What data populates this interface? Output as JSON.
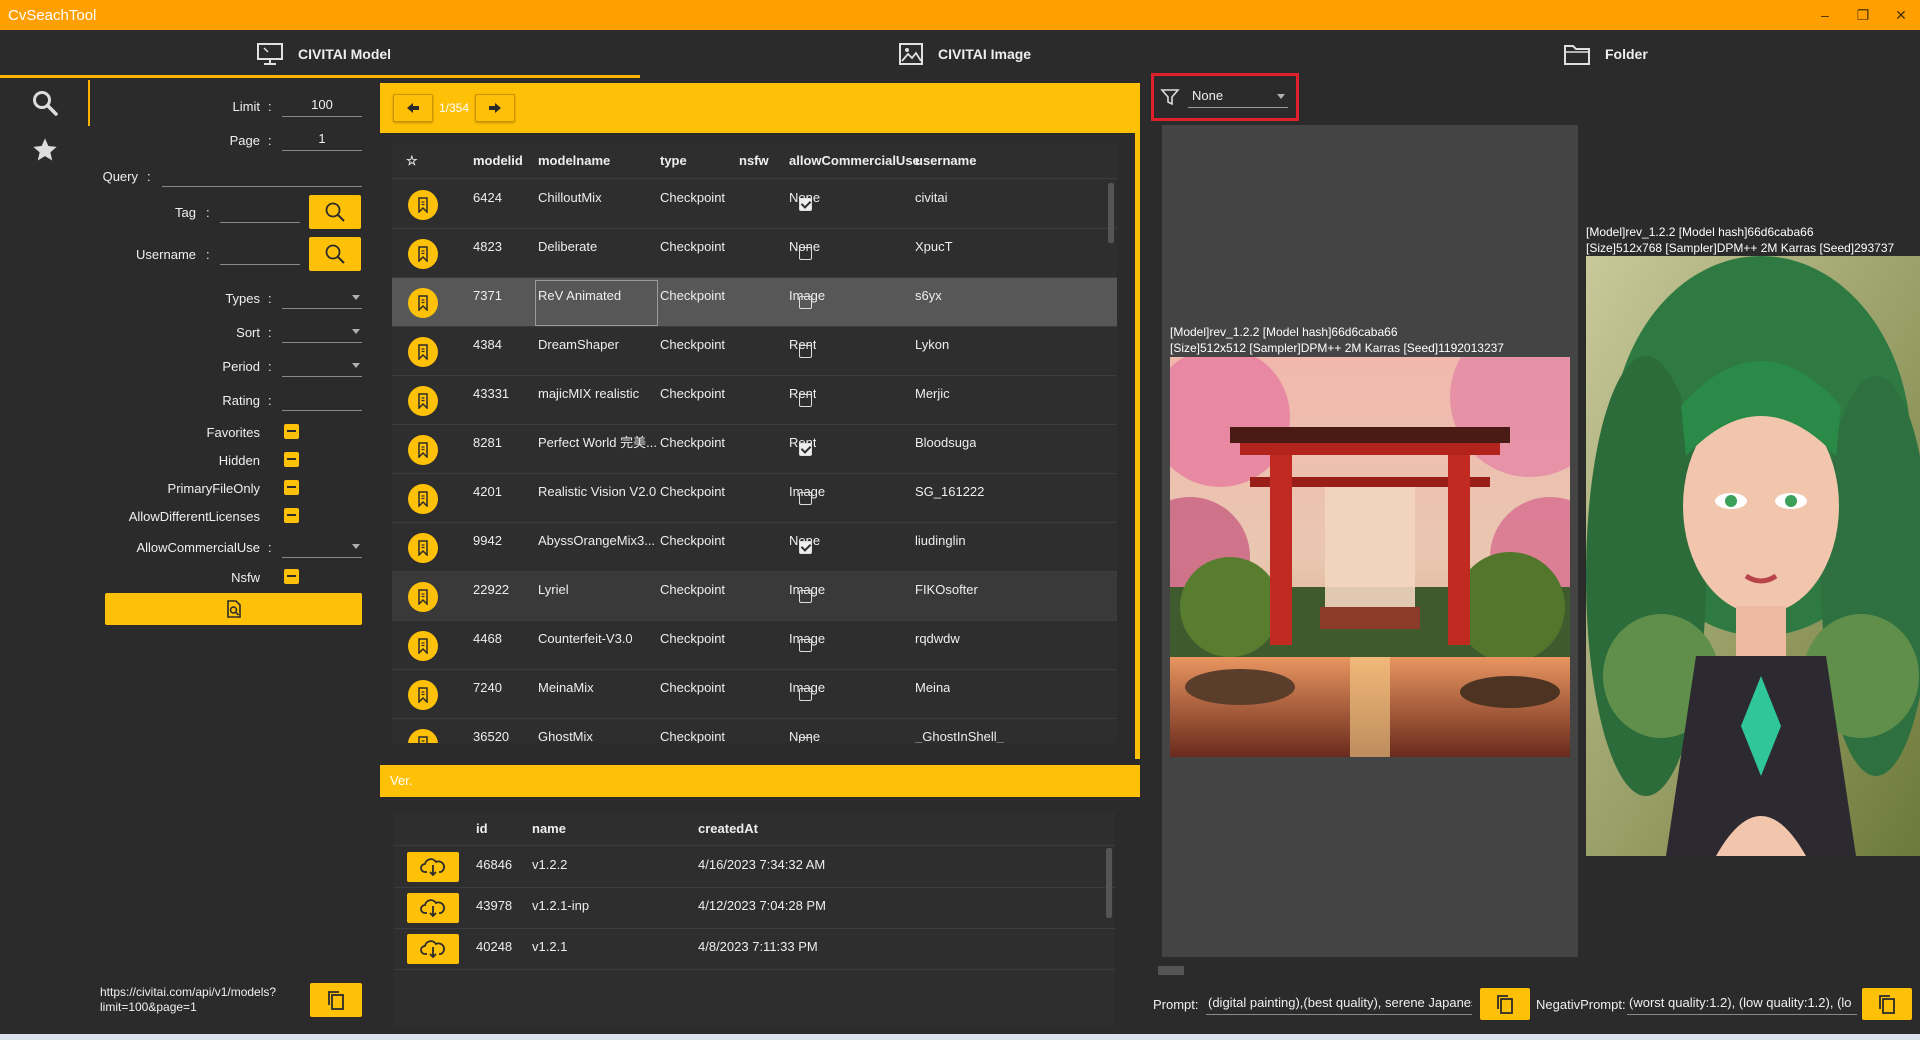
{
  "app": {
    "title": "CvSeachTool"
  },
  "window_controls": {
    "minimize": "–",
    "restore": "❐",
    "close": "✕"
  },
  "tabs": [
    {
      "label": "CIVITAI Model",
      "icon": "monitor-icon",
      "active": true
    },
    {
      "label": "CIVITAI Image",
      "icon": "image-icon",
      "active": false
    },
    {
      "label": "Folder",
      "icon": "folder-icon",
      "active": false
    }
  ],
  "nav": [
    {
      "icon": "search-icon",
      "active": true
    },
    {
      "icon": "star-icon",
      "active": false
    }
  ],
  "form": {
    "limit": {
      "label": "Limit",
      "value": "100"
    },
    "page": {
      "label": "Page",
      "value": "1"
    },
    "query": {
      "label": "Query",
      "value": ""
    },
    "tag": {
      "label": "Tag",
      "value": ""
    },
    "username": {
      "label": "Username",
      "value": ""
    },
    "types": {
      "label": "Types",
      "value": ""
    },
    "sort": {
      "label": "Sort",
      "value": ""
    },
    "period": {
      "label": "Period",
      "value": ""
    },
    "rating": {
      "label": "Rating",
      "value": ""
    },
    "favorites": {
      "label": "Favorites",
      "state": "indeterminate"
    },
    "hidden": {
      "label": "Hidden",
      "state": "indeterminate"
    },
    "primary_file_only": {
      "label": "PrimaryFileOnly",
      "state": "indeterminate"
    },
    "allow_different_licenses": {
      "label": "AllowDifferentLicenses",
      "state": "indeterminate"
    },
    "allow_commercial_use": {
      "label": "AllowCommercialUse",
      "value": ""
    },
    "nsfw": {
      "label": "Nsfw",
      "state": "indeterminate"
    },
    "colon": ":"
  },
  "api_url": {
    "text": "https://civitai.com/api/v1/models?limit=100&page=1"
  },
  "models": {
    "pager": {
      "current": "1/354"
    },
    "columns": [
      "☆",
      "modelid",
      "modelname",
      "type",
      "nsfw",
      "allowCommercialUse",
      "username"
    ],
    "rows": [
      {
        "modelid": "6424",
        "modelname": "ChilloutMix",
        "type": "Checkpoint",
        "nsfw": true,
        "allowCommercialUse": "None",
        "username": "civitai"
      },
      {
        "modelid": "4823",
        "modelname": "Deliberate",
        "type": "Checkpoint",
        "nsfw": false,
        "allowCommercialUse": "None",
        "username": "XpucT"
      },
      {
        "modelid": "7371",
        "modelname": "ReV Animated",
        "type": "Checkpoint",
        "nsfw": false,
        "allowCommercialUse": "Image",
        "username": "s6yx"
      },
      {
        "modelid": "4384",
        "modelname": "DreamShaper",
        "type": "Checkpoint",
        "nsfw": false,
        "allowCommercialUse": "Rent",
        "username": "Lykon"
      },
      {
        "modelid": "43331",
        "modelname": "majicMIX realistic",
        "type": "Checkpoint",
        "nsfw": false,
        "allowCommercialUse": "Rent",
        "username": "Merjic"
      },
      {
        "modelid": "8281",
        "modelname": "Perfect World 完美...",
        "type": "Checkpoint",
        "nsfw": true,
        "allowCommercialUse": "Rent",
        "username": "Bloodsuga"
      },
      {
        "modelid": "4201",
        "modelname": "Realistic Vision V2.0",
        "type": "Checkpoint",
        "nsfw": false,
        "allowCommercialUse": "Image",
        "username": "SG_161222"
      },
      {
        "modelid": "9942",
        "modelname": "AbyssOrangeMix3...",
        "type": "Checkpoint",
        "nsfw": true,
        "allowCommercialUse": "None",
        "username": "liudinglin"
      },
      {
        "modelid": "22922",
        "modelname": "Lyriel",
        "type": "Checkpoint",
        "nsfw": false,
        "allowCommercialUse": "Image",
        "username": "FIKOsofter"
      },
      {
        "modelid": "4468",
        "modelname": " Counterfeit-V3.0",
        "type": "Checkpoint",
        "nsfw": false,
        "allowCommercialUse": "Image",
        "username": "rqdwdw"
      },
      {
        "modelid": "7240",
        "modelname": "MeinaMix",
        "type": "Checkpoint",
        "nsfw": false,
        "allowCommercialUse": "Image",
        "username": "Meina"
      },
      {
        "modelid": "36520",
        "modelname": "GhostMix",
        "type": "Checkpoint",
        "nsfw": false,
        "allowCommercialUse": "None",
        "username": "_GhostInShell_"
      }
    ]
  },
  "versions": {
    "header": "Ver.",
    "columns": [
      "id",
      "name",
      "createdAt"
    ],
    "rows": [
      {
        "id": "46846",
        "name": "v1.2.2",
        "createdAt": "4/16/2023 7:34:32 AM"
      },
      {
        "id": "43978",
        "name": "v1.2.1-inp",
        "createdAt": "4/12/2023 7:04:28 PM"
      },
      {
        "id": "40248",
        "name": "v1.2.1",
        "createdAt": "4/8/2023 7:11:33 PM"
      }
    ]
  },
  "image_filter": {
    "value": "None"
  },
  "images": [
    {
      "caption_line1": "[Model]rev_1.2.2 [Model hash]66d6caba66",
      "caption_line2": "[Size]512x512 [Sampler]DPM++ 2M Karras [Seed]1192013237",
      "subject": "torii-gate-landscape"
    },
    {
      "caption_line1": "[Model]rev_1.2.2 [Model hash]66d6caba66",
      "caption_line2": "[Size]512x768 [Sampler]DPM++ 2M Karras [Seed]293737",
      "subject": "green-hair-portrait"
    }
  ],
  "prompt": {
    "prompt_label": "Prompt:",
    "prompt_value": "(digital painting),(best quality), serene Japanese",
    "negative_label": "NegativPrompt:",
    "negative_value": "(worst quality:1.2), (low quality:1.2), (lo"
  },
  "colors": {
    "accent": "#ffc107",
    "titlebar": "#ffa000",
    "background": "#2b2b2b",
    "highlight": "#e0202a"
  }
}
